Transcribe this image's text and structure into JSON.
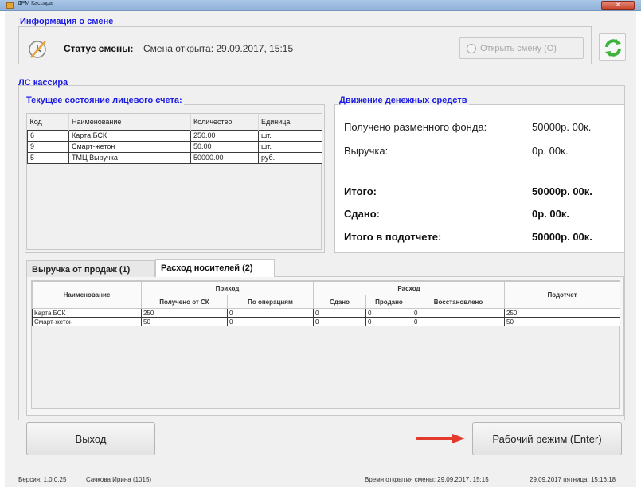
{
  "window": {
    "title": "ДРМ Кассира",
    "close_label": "✕"
  },
  "shift": {
    "section_title": "Информация о смене",
    "status_label": "Статус смены:",
    "status_value": "Смена открыта: 29.09.2017, 15:15",
    "open_button_label": "Открыть смену (O)"
  },
  "ls": {
    "section_title": "ЛС кассира",
    "state": {
      "title": "Текущее состояние лицевого счета:",
      "columns": [
        "Код",
        "Наименование",
        "Количество",
        "Единица"
      ],
      "rows": [
        [
          "6",
          "Карта БСК",
          "250.00",
          "шт."
        ],
        [
          "9",
          "Смарт-жетон",
          "50.00",
          "шт."
        ],
        [
          "5",
          "ТМЦ Выручка",
          "50000.00",
          "руб."
        ]
      ]
    },
    "money": {
      "title": "Движение денежных средств",
      "rows": [
        {
          "label": "Получено разменного фонда:",
          "value": "50000р. 00к."
        },
        {
          "label": "Выручка:",
          "value": "0р. 00к."
        },
        {
          "label": "Итого:",
          "value": "50000р. 00к."
        },
        {
          "label": "Сдано:",
          "value": "0р. 00к."
        },
        {
          "label": "Итого в подотчете:",
          "value": "50000р. 00к."
        }
      ]
    },
    "tabs": [
      "Выручка от продаж (1)",
      "Расход носителей (2)"
    ],
    "media": {
      "headers": {
        "name": "Наименование",
        "income": "Приход",
        "expense": "Расход",
        "report": "Подотчет",
        "received": "Получено от СК",
        "by_ops": "По операциям",
        "handed": "Сдано",
        "sold": "Продано",
        "restored": "Восстановлено"
      },
      "rows": [
        [
          "Карта БСК",
          "250",
          "0",
          "0",
          "0",
          "0",
          "250"
        ],
        [
          "Смарт-жетон",
          "50",
          "0",
          "0",
          "0",
          "0",
          "50"
        ]
      ]
    }
  },
  "buttons": {
    "exit": "Выход",
    "work_mode": "Рабочий режим (Enter)"
  },
  "statusbar": {
    "version": "Версия: 1.0.0.25",
    "user": "Сачкова Ирина (1015)",
    "shift_open_time": "Время открытия смены: 29.09.2017, 15:15",
    "datetime": "29.09.2017 пятница, 15:16:18"
  },
  "icons": {
    "clock": "clock-icon",
    "refresh": "refresh-icon",
    "arrow": "red-arrow-icon"
  },
  "colors": {
    "section_title": "#1a1ae6",
    "refresh_green": "#3cb43c",
    "arrow_red": "#e23b2e"
  }
}
